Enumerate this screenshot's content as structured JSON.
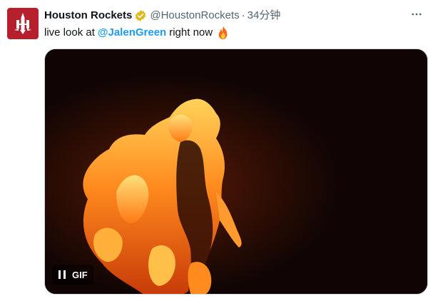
{
  "author": {
    "display_name": "Houston Rockets",
    "handle": "@HoustonRockets",
    "separator": "·",
    "time_ago": "34分钟",
    "verified_icon": "verified-badge-icon",
    "avatar_icon": "houston-rockets-logo",
    "brand_color": "#b6202d"
  },
  "tweet": {
    "text_before": "live look at",
    "mention": "@JalenGreen",
    "text_after": "right now",
    "emoji": "fire-emoji",
    "link_color": "#1d9bf0"
  },
  "media": {
    "type": "gif",
    "badge_label": "GIF",
    "control_icon": "pause-icon"
  },
  "actions": {
    "more_icon": "more-options-icon"
  }
}
